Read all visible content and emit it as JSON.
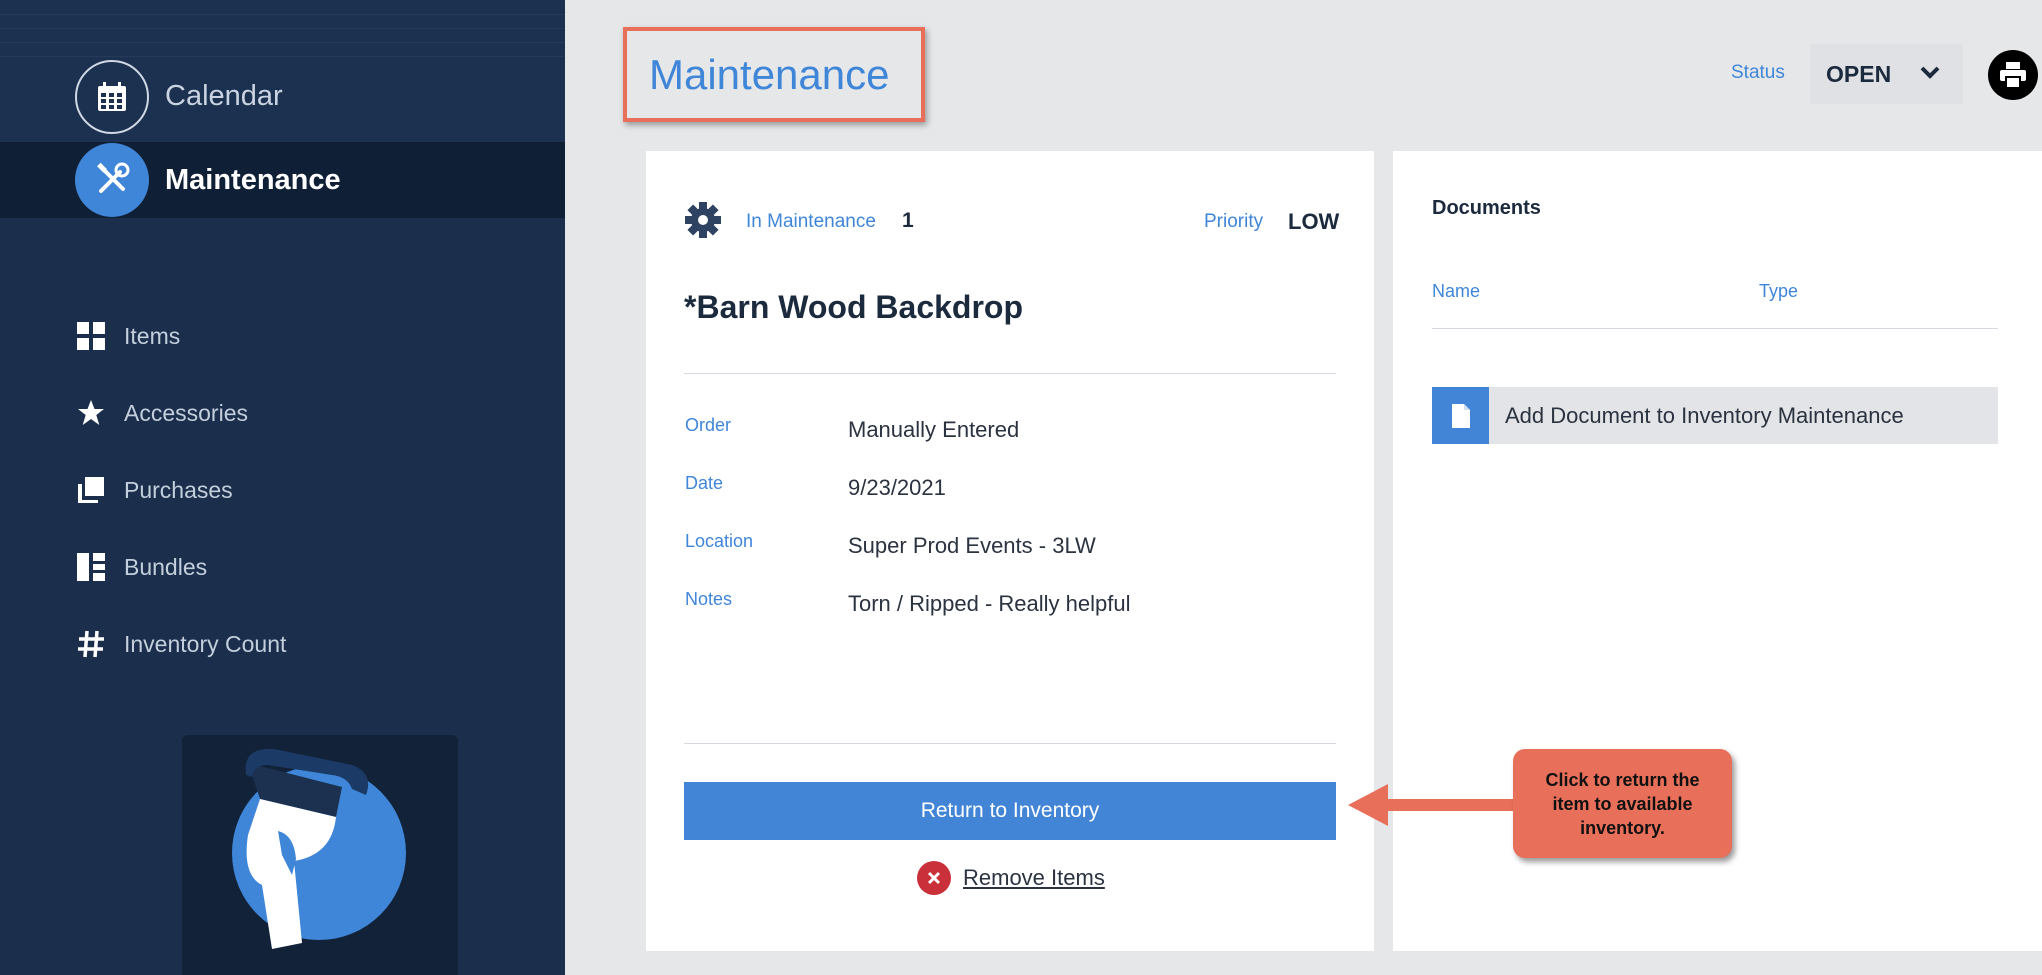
{
  "sidebar": {
    "calendar_label": "Calendar",
    "maintenance_label": "Maintenance",
    "items": [
      {
        "label": "Items",
        "icon": "grid-icon"
      },
      {
        "label": "Accessories",
        "icon": "star-icon"
      },
      {
        "label": "Purchases",
        "icon": "stack-icon"
      },
      {
        "label": "Bundles",
        "icon": "bundles-icon"
      },
      {
        "label": "Inventory Count",
        "icon": "hash-icon"
      }
    ]
  },
  "header": {
    "title": "Maintenance",
    "status_label": "Status",
    "status_value": "OPEN"
  },
  "detail": {
    "in_maintenance_label": "In Maintenance",
    "in_maintenance_value": "1",
    "priority_label": "Priority",
    "priority_value": "LOW",
    "item_title": "*Barn Wood Backdrop",
    "fields": [
      {
        "label": "Order",
        "value": "Manually Entered"
      },
      {
        "label": "Date",
        "value": "9/23/2021"
      },
      {
        "label": "Location",
        "value": "Super Prod Events - 3LW"
      },
      {
        "label": "Notes",
        "value": "Torn / Ripped - Really helpful"
      }
    ],
    "return_button": "Return to Inventory",
    "remove_link": "Remove Items"
  },
  "documents": {
    "title": "Documents",
    "col_name": "Name",
    "col_type": "Type",
    "add_button": "Add Document to Inventory Maintenance"
  },
  "callout": {
    "text": "Click to return the item to available inventory."
  },
  "colors": {
    "sidebar_bg": "#1b2f4c",
    "accent": "#4285d6",
    "callout": "#e8705a"
  }
}
